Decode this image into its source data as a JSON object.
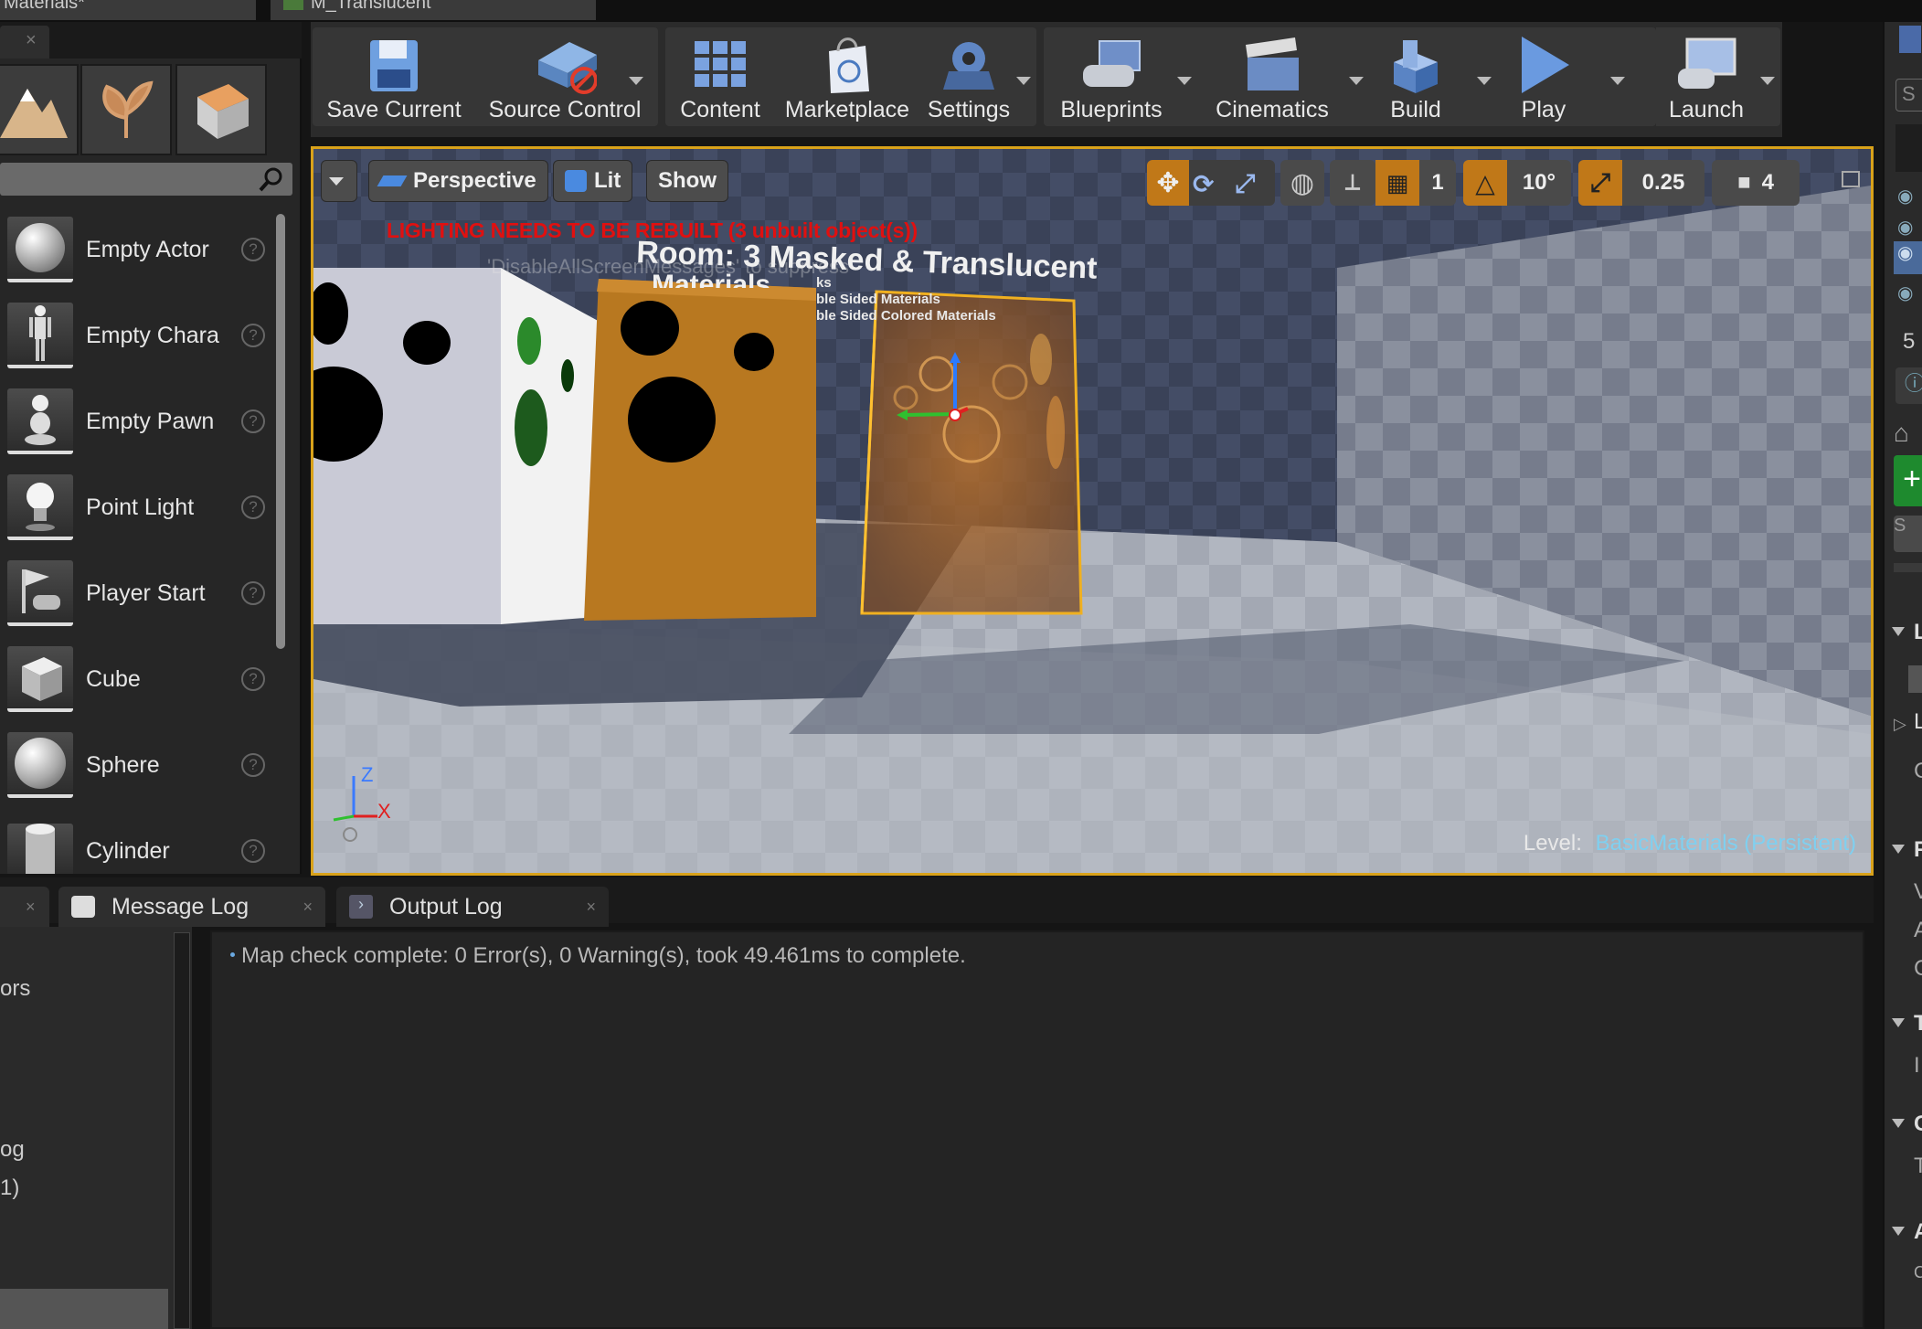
{
  "tabs": {
    "left_doc": "Materials*",
    "right_doc": "M_Translucent"
  },
  "place_items": [
    {
      "label": "Empty Actor"
    },
    {
      "label": "Empty Chara"
    },
    {
      "label": "Empty Pawn"
    },
    {
      "label": "Point Light"
    },
    {
      "label": "Player Start"
    },
    {
      "label": "Cube"
    },
    {
      "label": "Sphere"
    },
    {
      "label": "Cylinder"
    }
  ],
  "toolbar": {
    "save": "Save Current",
    "source_control": "Source Control",
    "content": "Content",
    "marketplace": "Marketplace",
    "settings": "Settings",
    "blueprints": "Blueprints",
    "cinematics": "Cinematics",
    "build": "Build",
    "play": "Play",
    "launch": "Launch"
  },
  "viewport": {
    "perspective": "Perspective",
    "lit": "Lit",
    "show": "Show",
    "grid_snap": "1",
    "rotation_snap": "10°",
    "scale_snap": "0.25",
    "camera_speed": "4",
    "warning": "LIGHTING NEEDS TO BE REBUILT (3 unbuilt object(s))",
    "warning_hint": "'DisableAllScreenMessages' to suppress",
    "room_title": "Room: 3 Masked & Translucent",
    "room_title_2": "Materials",
    "scene_text_1": "ks",
    "scene_text_2": "ble Sided Materials",
    "scene_text_3": "ble Sided Colored Materials",
    "axis_z": "Z",
    "axis_x": "X",
    "level_label": "Level:",
    "level_name": "BasicMaterials (Persistent)"
  },
  "bottom": {
    "message_log": "Message Log",
    "output_log": "Output Log",
    "left_fragments": [
      "ors",
      "og",
      "1)"
    ],
    "log_line": "Map check complete: 0 Error(s), 0 Warning(s), took 49.461ms to complete."
  },
  "right_panel": {
    "field_char": "S",
    "number": "5",
    "sections": [
      "L",
      "L",
      "F",
      "T",
      "C",
      "A"
    ],
    "fragments": [
      "C",
      "V",
      "A",
      "C",
      "I",
      "T",
      "C"
    ]
  },
  "colors": {
    "accent_orange": "#d9a21a",
    "warning_red": "#e01010",
    "level_name": "#7fd0f0",
    "active_snap": "#c07818"
  }
}
